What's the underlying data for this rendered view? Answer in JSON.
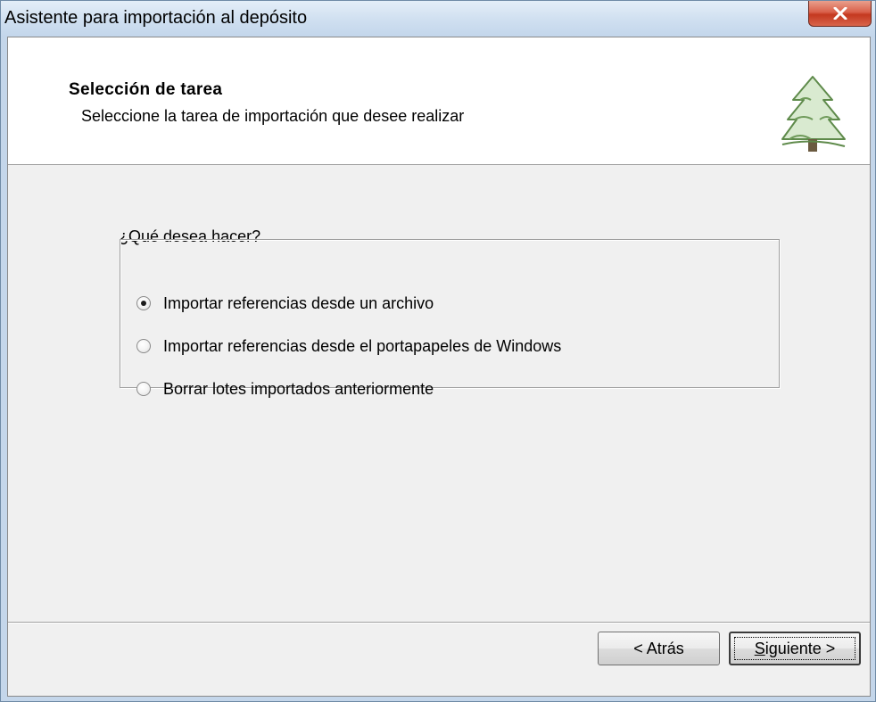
{
  "window": {
    "title": "Asistente para importación al depósito",
    "close_icon": "close-icon"
  },
  "header": {
    "title": "Selección de tarea",
    "subtitle": "Seleccione la tarea de importación que desee realizar",
    "icon": "tree-icon"
  },
  "body": {
    "question": "¿Qué desea hacer?",
    "options": [
      {
        "label": "Importar referencias desde un archivo",
        "checked": true
      },
      {
        "label": "Importar referencias desde el portapapeles de Windows",
        "checked": false
      },
      {
        "label": "Borrar lotes importados anteriormente",
        "checked": false
      }
    ]
  },
  "footer": {
    "back_label": "< Atrás",
    "next_mnemonic": "S",
    "next_rest": "iguiente >"
  },
  "colors": {
    "close_button": "#c4381f",
    "client_bg": "#f0f0f0",
    "frame": "#c4d6ea"
  }
}
